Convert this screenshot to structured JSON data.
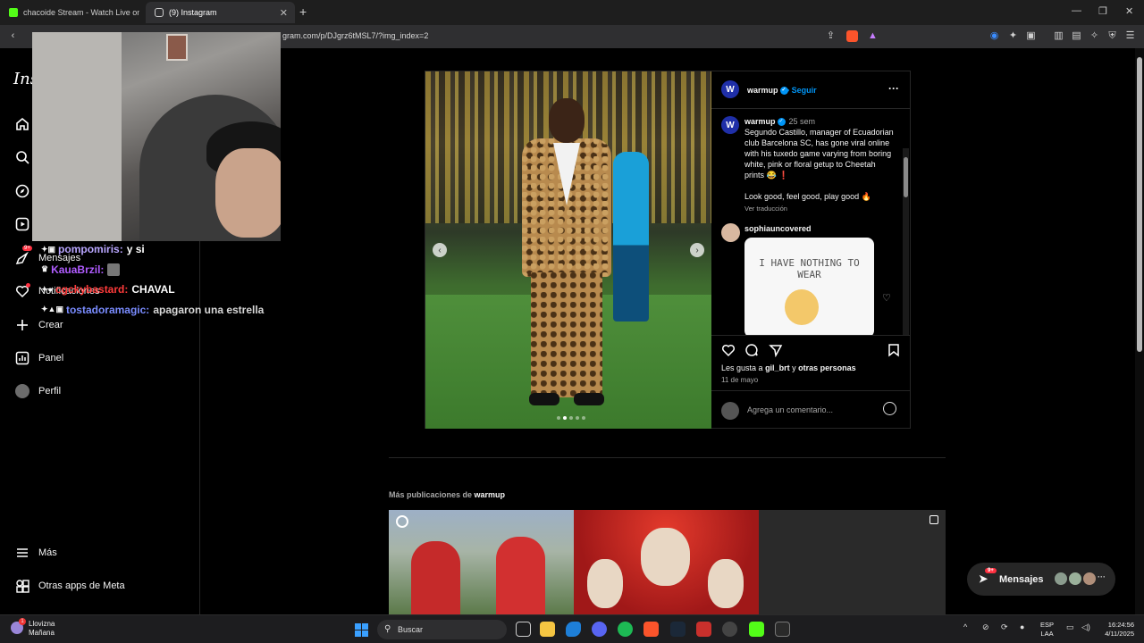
{
  "browser": {
    "tabs": [
      {
        "title": "chacoide Stream - Watch Live on"
      },
      {
        "title": "(9) Instagram"
      }
    ],
    "url": "gram.com/p/DJgrz6tMSL7/?img_index=2"
  },
  "sidebar": {
    "logo": "Ins",
    "items": [
      {
        "label": "",
        "icon": "home-icon"
      },
      {
        "label": "",
        "icon": "search-icon"
      },
      {
        "label": "",
        "icon": "explore-icon"
      },
      {
        "label": "",
        "icon": "reels-icon"
      },
      {
        "label": "Mensajes",
        "icon": "messenger-icon",
        "badge": "9+"
      },
      {
        "label": "Notificaciones",
        "icon": "heart-icon"
      },
      {
        "label": "Crear",
        "icon": "plus-icon"
      },
      {
        "label": "Panel",
        "icon": "dashboard-icon"
      },
      {
        "label": "Perfil",
        "icon": "avatar"
      },
      {
        "label": "Más",
        "icon": "menu-icon"
      },
      {
        "label": "Otras apps de Meta",
        "icon": "meta-apps-icon"
      }
    ]
  },
  "stream_chat": [
    {
      "user": "pompomiris:",
      "message": "y si",
      "color": "#b9a6ff"
    },
    {
      "user": "KauaBrzil:",
      "message": "",
      "color": "#b05cff"
    },
    {
      "user": "cgckybastard:",
      "message": "CHAVAL",
      "color": "#ff3b3b"
    },
    {
      "user": "tostadoramagic:",
      "message": "apagaron una estrella",
      "color": "#7a8cff"
    }
  ],
  "post": {
    "author": "warmup",
    "follow": "• Seguir",
    "caption_author": "warmup",
    "caption_time": "25 sem",
    "caption": "Segundo Castillo, manager of Ecuadorian club Barcelona SC, has gone viral online with his tuxedo game varying from boring white, pink or floral getup to Cheetah prints 😂 ❗",
    "caption_line2": "Look good, feel good, play good 🔥",
    "translate": "Ver traducción",
    "comment_user": "sophiauncovered",
    "gif_text": "I HAVE NOTHING TO WEAR",
    "likes_prefix": "Les gusta a",
    "likes_user": "gil_brt",
    "likes_mid": "y",
    "likes_others": "otras personas",
    "date": "11 de mayo",
    "add_comment": "Agrega un comentario..."
  },
  "more_posts": {
    "prefix": "Más publicaciones de",
    "author": "warmup"
  },
  "messages_button": {
    "label": "Mensajes",
    "badge": "9+"
  },
  "taskbar": {
    "weather_title": "Llovizna",
    "weather_sub": "Mañana",
    "weather_badge": "1",
    "search_placeholder": "Buscar",
    "lang_top": "ESP",
    "lang_bottom": "LAA",
    "time": "16:24:56",
    "date": "4/11/2025"
  },
  "colors": {
    "accent": "#0095f6",
    "badge": "#ff3040",
    "brand_warmup": "#1f2fa8"
  }
}
